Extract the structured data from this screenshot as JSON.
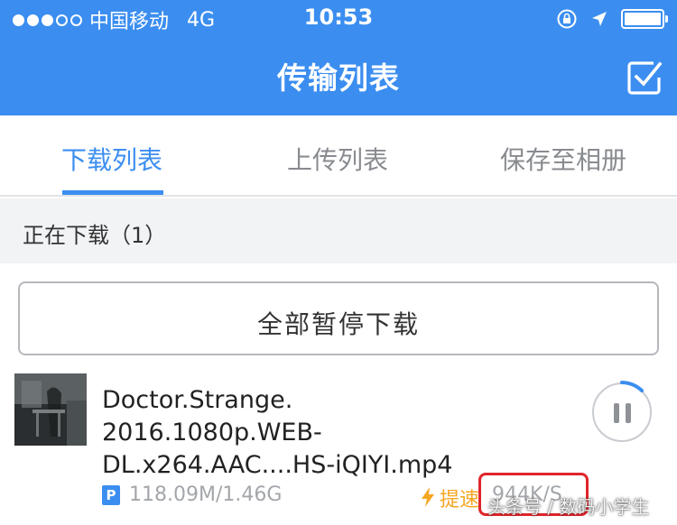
{
  "status_bar": {
    "carrier": "中国移动",
    "network": "4G",
    "time": "10:53",
    "signal_bars_filled": 3,
    "signal_bars_total": 5
  },
  "nav": {
    "title": "传输列表",
    "edit_icon": "checkbox-edit-icon"
  },
  "tabs": [
    {
      "label": "下载列表",
      "active": true
    },
    {
      "label": "上传列表",
      "active": false
    },
    {
      "label": "保存至相册",
      "active": false
    }
  ],
  "section": {
    "title": "正在下载（1）"
  },
  "pause_all_label": "全部暂停下载",
  "download": {
    "filename": "Doctor.Strange.\n2016.1080p.WEB-\nDL.x264.AAC....HS-iQIYI.mp4",
    "badge": "P",
    "size": "118.09M/1.46G",
    "speedup_label": "提速",
    "speed": "944K/S"
  },
  "watermark": "头条号 / 数码小学生",
  "colors": {
    "accent": "#3b8ef0",
    "speedup": "#f5a623",
    "highlight": "#e0252b"
  }
}
